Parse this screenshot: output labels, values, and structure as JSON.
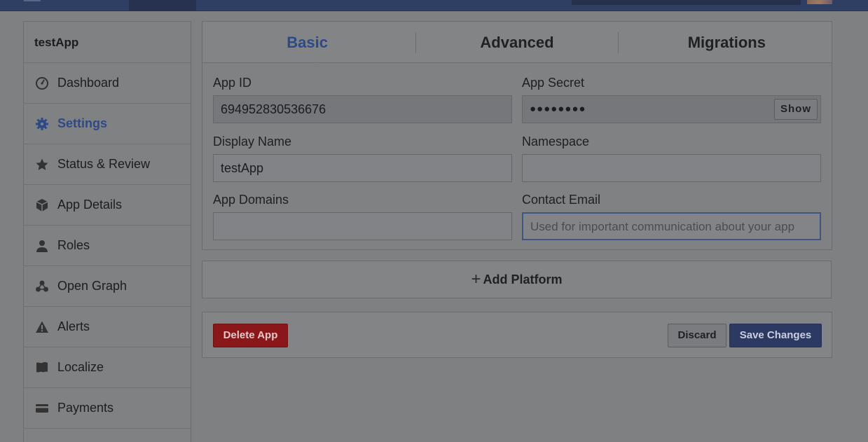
{
  "sidebar": {
    "app_name": "testApp",
    "items": [
      {
        "label": "Dashboard",
        "icon": "dashboard-icon",
        "active": false
      },
      {
        "label": "Settings",
        "icon": "gear-icon",
        "active": true
      },
      {
        "label": "Status & Review",
        "icon": "star-icon",
        "active": false
      },
      {
        "label": "App Details",
        "icon": "cube-icon",
        "active": false
      },
      {
        "label": "Roles",
        "icon": "person-icon",
        "active": false
      },
      {
        "label": "Open Graph",
        "icon": "graph-icon",
        "active": false
      },
      {
        "label": "Alerts",
        "icon": "warning-icon",
        "active": false
      },
      {
        "label": "Localize",
        "icon": "flag-icon",
        "active": false
      },
      {
        "label": "Payments",
        "icon": "card-icon",
        "active": false
      }
    ]
  },
  "tabs": [
    "Basic",
    "Advanced",
    "Migrations"
  ],
  "form": {
    "app_id_label": "App ID",
    "app_id_value": "694952830536676",
    "app_secret_label": "App Secret",
    "app_secret_value": "●●●●●●●●",
    "show_label": "Show",
    "display_name_label": "Display Name",
    "display_name_value": "testApp",
    "namespace_label": "Namespace",
    "namespace_value": "",
    "app_domains_label": "App Domains",
    "app_domains_value": "",
    "contact_email_label": "Contact Email",
    "contact_email_placeholder": "Used for important communication about your app"
  },
  "add_platform_label": "Add Platform",
  "footer": {
    "delete_label": "Delete App",
    "discard_label": "Discard",
    "save_label": "Save Changes"
  },
  "colors": {
    "accent": "#3b5998",
    "danger": "#c0272d",
    "overlay": "#7f8082"
  }
}
